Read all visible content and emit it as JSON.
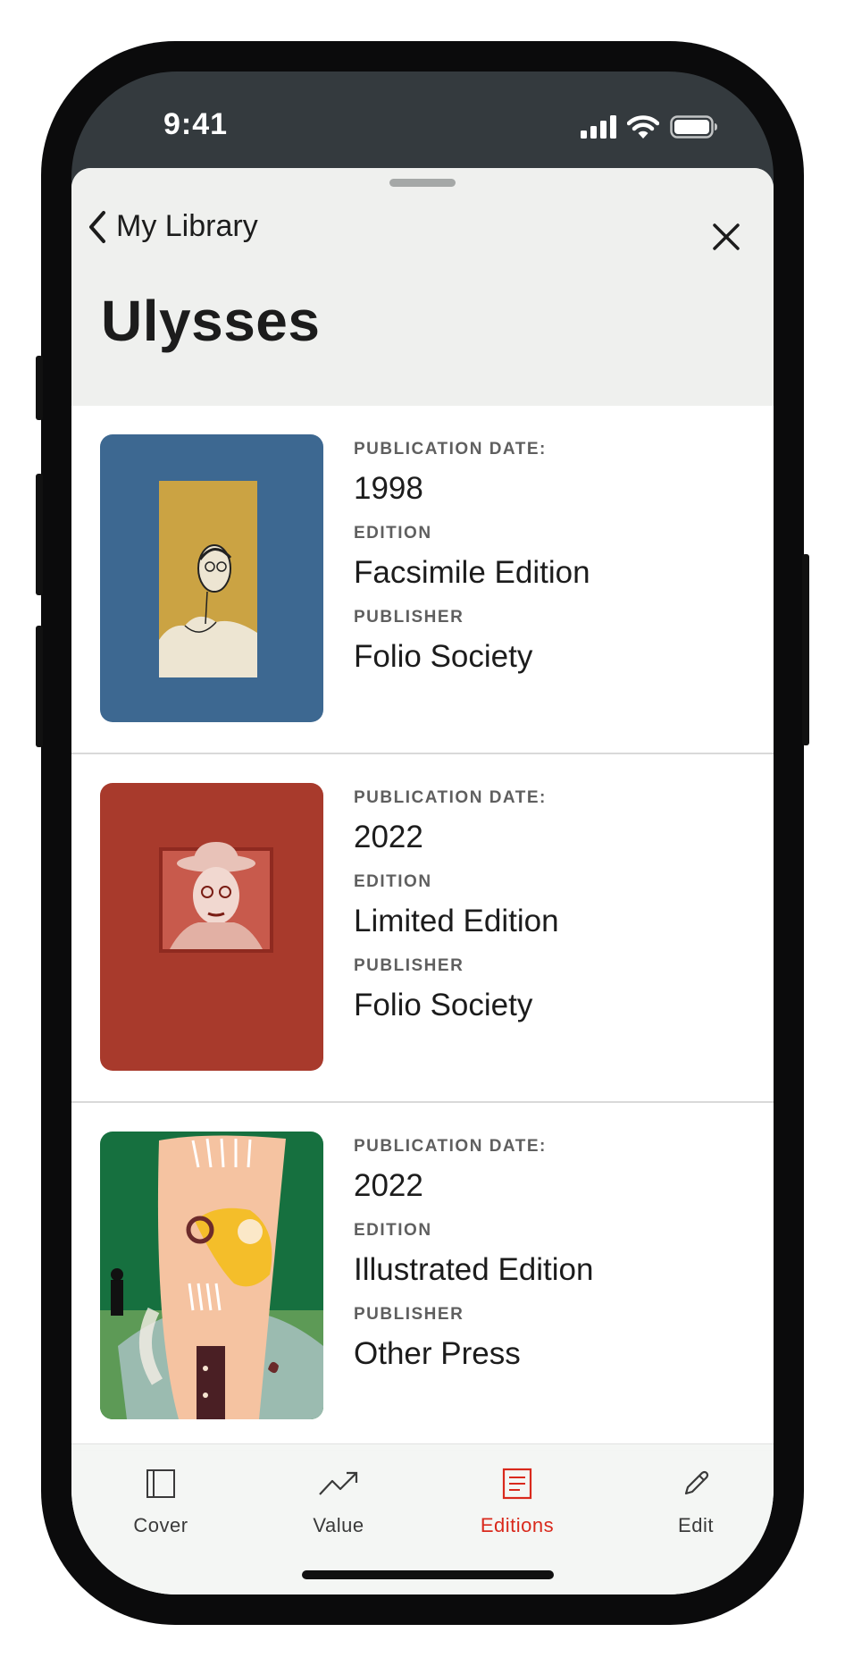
{
  "status_bar": {
    "time": "9:41"
  },
  "sheet": {
    "back_label": "My Library",
    "title": "Ulysses"
  },
  "labels": {
    "publication_date": "PUBLICATION DATE:",
    "edition": "EDITION",
    "publisher": "PUBLISHER"
  },
  "editions": [
    {
      "year": "1998",
      "edition": "Facsimile Edition",
      "publisher": "Folio Society",
      "cover_color": "#3d6891"
    },
    {
      "year": "2022",
      "edition": "Limited Edition",
      "publisher": "Folio Society",
      "cover_color": "#a83a2c"
    },
    {
      "year": "2022",
      "edition": "Illustrated Edition",
      "publisher": "Other Press",
      "cover_color": "#16703f"
    }
  ],
  "tabs": [
    {
      "label": "Cover",
      "icon": "book-cover-icon"
    },
    {
      "label": "Value",
      "icon": "trend-up-icon"
    },
    {
      "label": "Editions",
      "icon": "list-document-icon",
      "active": true
    },
    {
      "label": "Edit",
      "icon": "pencil-icon"
    }
  ],
  "colors": {
    "accent": "#d9291c",
    "header_bg": "#eff0ee",
    "status_bg": "#343a3e"
  }
}
